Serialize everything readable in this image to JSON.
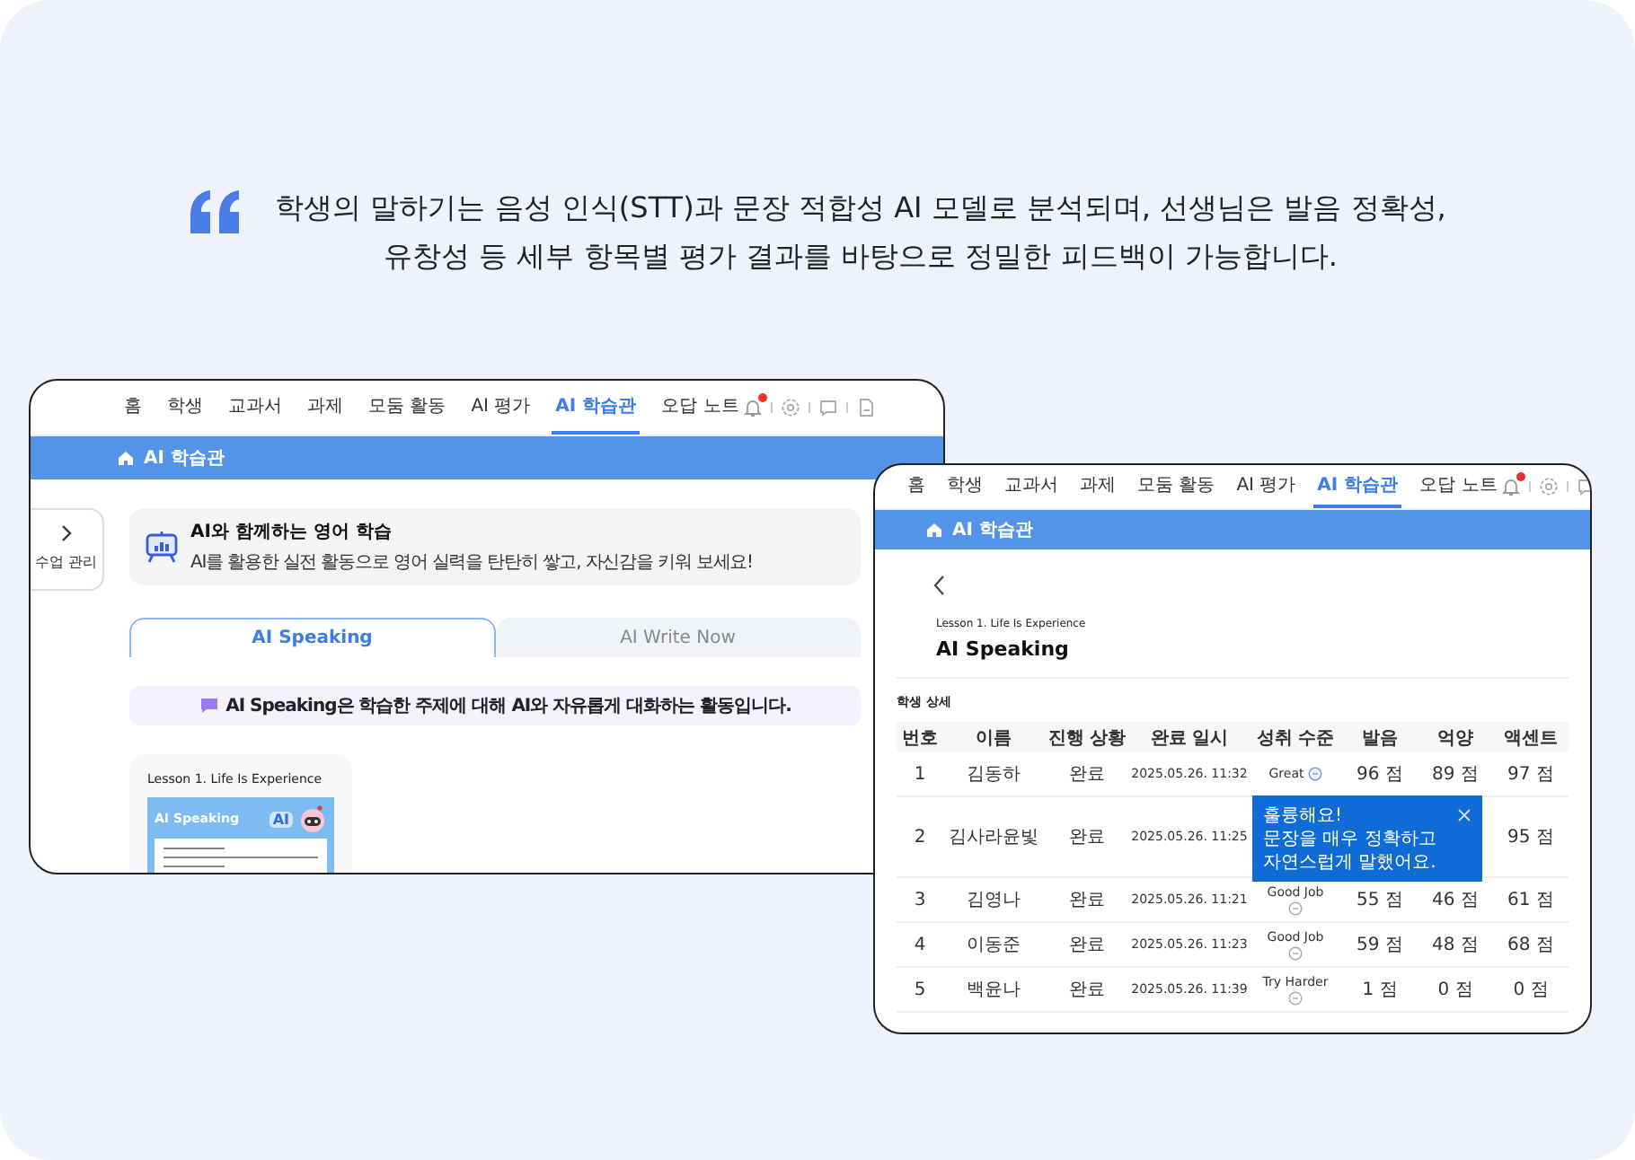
{
  "quote": {
    "lines": [
      "학생의 말하기는 음성 인식(STT)과 문장 적합성 AI 모델로 분석되며, 선생님은 발음 정확성,",
      "유창성 등 세부 항목별 평가 결과를 바탕으로 정밀한 피드백이 가능합니다."
    ]
  },
  "overview_window": {
    "nav": [
      {
        "label": "홈",
        "selected": false
      },
      {
        "label": "학생",
        "selected": false
      },
      {
        "label": "교과서",
        "selected": false
      },
      {
        "label": "과제",
        "selected": false
      },
      {
        "label": "모둠 활동",
        "selected": false
      },
      {
        "label": "AI 평가",
        "selected": false
      },
      {
        "label": "AI 학습관",
        "selected": true
      },
      {
        "label": "오답 노트",
        "selected": false
      }
    ],
    "notification": true,
    "breadcrumb": "AI 학습관",
    "side_toggle": "수업 관리",
    "banner": {
      "title": "AI와 함께하는 영어 학습",
      "text": "AI를 활용한 실전 활동으로 영어 실력을 탄탄히 쌓고, 자신감을 키워 보세요!"
    },
    "tabs": [
      {
        "label": "AI Speaking",
        "selected": true
      },
      {
        "label": "AI Write Now",
        "selected": false
      }
    ],
    "info": "AI Speaking은 학습한 주제에 대해 AI와 자유롭게 대화하는 활동입니다.",
    "lesson_card": {
      "title": "Lesson 1. Life Is Experience",
      "thumbnail_title": "AI Speaking",
      "thumbnail_badge": "AI"
    }
  },
  "detail_window": {
    "nav": [
      {
        "label": "홈",
        "selected": false
      },
      {
        "label": "학생",
        "selected": false
      },
      {
        "label": "교과서",
        "selected": false
      },
      {
        "label": "과제",
        "selected": false
      },
      {
        "label": "모둠 활동",
        "selected": false
      },
      {
        "label": "AI 평가",
        "selected": false
      },
      {
        "label": "AI 학습관",
        "selected": true
      },
      {
        "label": "오답 노트",
        "selected": false
      }
    ],
    "notification": true,
    "breadcrumb": "AI 학습관",
    "lesson": "Lesson 1. Life Is Experience",
    "title": "AI Speaking",
    "section": "학생 상세",
    "table": {
      "columns": [
        "번호",
        "이름",
        "진행 상황",
        "완료 일시",
        "성취 수준",
        "발음",
        "억양",
        "액센트"
      ],
      "rows": [
        {
          "number": "1",
          "name": "김동하",
          "status": "완료",
          "date": "2025.05.26. 11:32",
          "achievement": "Great",
          "pronunciation": "96 점",
          "intonation": "89 점",
          "accent": "97 점",
          "feedback_open": true
        },
        {
          "number": "2",
          "name": "김사라윤빛",
          "status": "완료",
          "date": "2025.05.26. 11:25",
          "achievement": null,
          "pronunciation": null,
          "intonation": null,
          "accent": "95 점",
          "feedback_open": false
        },
        {
          "number": "3",
          "name": "김영나",
          "status": "완료",
          "date": "2025.05.26. 11:21",
          "achievement": "Good Job",
          "pronunciation": "55 점",
          "intonation": "46 점",
          "accent": "61 점",
          "feedback_open": false
        },
        {
          "number": "4",
          "name": "이동준",
          "status": "완료",
          "date": "2025.05.26. 11:23",
          "achievement": "Good Job",
          "pronunciation": "59 점",
          "intonation": "48 점",
          "accent": "68 점",
          "feedback_open": false
        },
        {
          "number": "5",
          "name": "백윤나",
          "status": "완료",
          "date": "2025.05.26. 11:39",
          "achievement": "Try Harder",
          "pronunciation": "1 점",
          "intonation": "0 점",
          "accent": "0 점",
          "feedback_open": false
        }
      ]
    },
    "tooltip": {
      "title": "훌륭해요!",
      "text": "문장을 매우 정확하고 자연스럽게 말했어요."
    }
  }
}
